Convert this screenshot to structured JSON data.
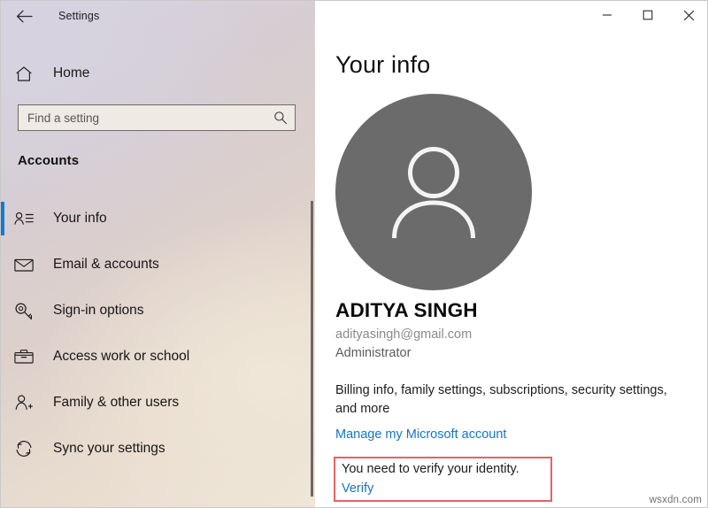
{
  "window": {
    "app_title": "Settings",
    "back_icon": "back-arrow-icon",
    "controls": {
      "minimize": "minimize-icon",
      "maximize": "maximize-icon",
      "close": "close-icon"
    }
  },
  "sidebar": {
    "home": {
      "label": "Home",
      "icon": "home-icon"
    },
    "search": {
      "placeholder": "Find a setting",
      "value": "",
      "icon": "search-icon"
    },
    "section_title": "Accounts",
    "items": [
      {
        "label": "Your info",
        "icon": "contact-card-icon",
        "selected": true
      },
      {
        "label": "Email & accounts",
        "icon": "envelope-icon",
        "selected": false
      },
      {
        "label": "Sign-in options",
        "icon": "key-icon",
        "selected": false
      },
      {
        "label": "Access work or school",
        "icon": "briefcase-icon",
        "selected": false
      },
      {
        "label": "Family & other users",
        "icon": "person-add-icon",
        "selected": false
      },
      {
        "label": "Sync your settings",
        "icon": "sync-icon",
        "selected": false
      }
    ],
    "accent_color": "#0c7cd5"
  },
  "main": {
    "page_title": "Your info",
    "avatar": {
      "icon": "person-avatar-icon",
      "background_color": "#6b6b6b"
    },
    "user_name": "ADITYA SINGH",
    "user_email": "adityasingh@gmail.com",
    "user_role": "Administrator",
    "billing_text": "Billing info, family settings, subscriptions, security settings, and more",
    "manage_link": "Manage my Microsoft account",
    "verify": {
      "message": "You need to verify your identity.",
      "link": "Verify",
      "highlight_color": "#e2636a"
    },
    "link_color": "#1673c4"
  },
  "watermark": "wsxdn.com"
}
